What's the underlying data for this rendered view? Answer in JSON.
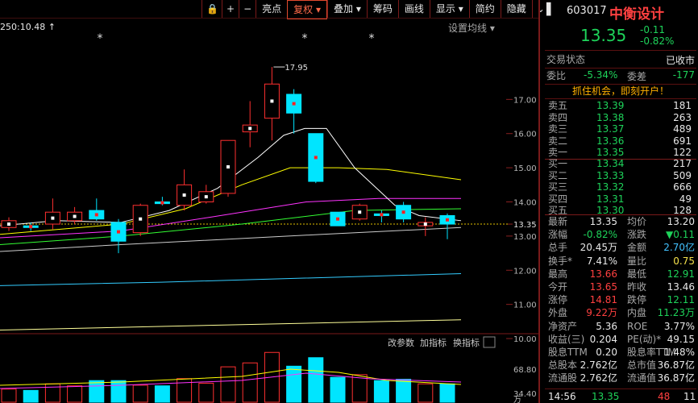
{
  "toolbar": {
    "buttons": [
      "亮点",
      "复权",
      "叠加",
      "筹码",
      "画线",
      "显示",
      "简约",
      "隐藏"
    ],
    "active": "复权"
  },
  "chart": {
    "top_left": "250:10.48",
    "ma_settings": "设置均线",
    "high_label": "17.95",
    "price_ticks": [
      "17.00",
      "16.00",
      "15.00",
      "14.00",
      "13.35",
      "13.00",
      "12.00",
      "11.00",
      "10.00"
    ],
    "vol_ticks": [
      "68.80",
      "34.40",
      "万"
    ],
    "bottom_buttons": [
      "改参数",
      "加指标",
      "换指标"
    ],
    "current_price": 13.35,
    "colors": {
      "up": "#ff3030",
      "down": "#00e5ff",
      "ma5": "#ffffff",
      "ma10": "#ffff00",
      "ma20": "#ff33ff",
      "ma30": "#33ff33",
      "ma60": "#cccccc",
      "ma120": "#33ccff",
      "ma250": "#ffff99"
    }
  },
  "chart_data": {
    "type": "candlestick",
    "ylim": [
      9.6,
      18.4
    ],
    "candles": [
      {
        "o": 13.25,
        "c": 13.45,
        "h": 13.55,
        "l": 13.15
      },
      {
        "o": 13.3,
        "c": 13.25,
        "h": 13.4,
        "l": 13.15
      },
      {
        "o": 13.35,
        "c": 13.7,
        "h": 14.1,
        "l": 13.2
      },
      {
        "o": 13.45,
        "c": 13.7,
        "h": 13.85,
        "l": 13.35
      },
      {
        "o": 13.75,
        "c": 13.5,
        "h": 14.1,
        "l": 13.45
      },
      {
        "o": 13.4,
        "c": 12.85,
        "h": 13.5,
        "l": 12.5
      },
      {
        "o": 13.1,
        "c": 13.9,
        "h": 13.95,
        "l": 13.0
      },
      {
        "o": 14.0,
        "c": 13.95,
        "h": 14.15,
        "l": 13.9
      },
      {
        "o": 13.9,
        "c": 14.5,
        "h": 14.95,
        "l": 13.75
      },
      {
        "o": 14.0,
        "c": 14.3,
        "h": 14.5,
        "l": 13.95
      },
      {
        "o": 14.25,
        "c": 15.8,
        "h": 15.8,
        "l": 14.15
      },
      {
        "o": 16.05,
        "c": 16.25,
        "h": 16.95,
        "l": 15.6
      },
      {
        "o": 16.45,
        "c": 17.45,
        "h": 17.95,
        "l": 15.8
      },
      {
        "o": 17.15,
        "c": 16.6,
        "h": 17.3,
        "l": 16.0
      },
      {
        "o": 16.0,
        "c": 14.6,
        "h": 16.0,
        "l": 14.55
      },
      {
        "o": 13.7,
        "c": 13.3,
        "h": 13.7,
        "l": 13.3
      },
      {
        "o": 13.5,
        "c": 13.9,
        "h": 13.95,
        "l": 13.45
      },
      {
        "o": 13.65,
        "c": 13.6,
        "h": 13.75,
        "l": 13.4
      },
      {
        "o": 13.9,
        "c": 13.5,
        "h": 14.0,
        "l": 13.4
      },
      {
        "o": 13.3,
        "c": 13.4,
        "h": 13.55,
        "l": 13.0
      },
      {
        "o": 13.6,
        "c": 13.35,
        "h": 13.66,
        "l": 12.91
      }
    ],
    "volumes": [
      20,
      18,
      28,
      25,
      33,
      33,
      26,
      25,
      36,
      29,
      54,
      60,
      76,
      55,
      68,
      38,
      42,
      33,
      35,
      28,
      28
    ]
  },
  "quote": {
    "code": "603017",
    "name": "中衡设计",
    "price": "13.35",
    "change": "-0.11",
    "change_pct": "-0.82%",
    "status_label": "交易状态",
    "status": "已收市",
    "ratio_label": "委比",
    "ratio": "-5.34%",
    "diff_label": "委差",
    "diff": "-177",
    "ad": "抓住机会，即刻开户！",
    "asks": [
      {
        "label": "卖五",
        "price": "13.39",
        "vol": "181"
      },
      {
        "label": "卖四",
        "price": "13.38",
        "vol": "263"
      },
      {
        "label": "卖三",
        "price": "13.37",
        "vol": "489"
      },
      {
        "label": "卖二",
        "price": "13.36",
        "vol": "691"
      },
      {
        "label": "卖一",
        "price": "13.35",
        "vol": "122"
      }
    ],
    "bids": [
      {
        "label": "买一",
        "price": "13.34",
        "vol": "217"
      },
      {
        "label": "买二",
        "price": "13.33",
        "vol": "509"
      },
      {
        "label": "买三",
        "price": "13.32",
        "vol": "666"
      },
      {
        "label": "买四",
        "price": "13.31",
        "vol": "49"
      },
      {
        "label": "买五",
        "price": "13.30",
        "vol": "128"
      }
    ],
    "stats": [
      [
        "最新",
        "13.35",
        "white",
        "均价",
        "13.20",
        "white"
      ],
      [
        "涨幅",
        "-0.82%",
        "green",
        "涨跌",
        "▼0.11",
        "green"
      ],
      [
        "总手",
        "20.45万",
        "white",
        "金额",
        "2.70亿",
        "cyan"
      ],
      [
        "换手*",
        "7.41%",
        "white",
        "量比",
        "0.75",
        "yellow"
      ],
      [
        "最高",
        "13.66",
        "red",
        "最低",
        "12.91",
        "green"
      ],
      [
        "今开",
        "13.65",
        "red",
        "昨收",
        "13.46",
        "white"
      ],
      [
        "涨停",
        "14.81",
        "red",
        "跌停",
        "12.11",
        "green"
      ],
      [
        "外盘",
        "9.22万",
        "red",
        "内盘",
        "11.23万",
        "green"
      ],
      [
        "净资产",
        "5.36",
        "white",
        "ROE",
        "3.77%",
        "white"
      ],
      [
        "收益(三)",
        "0.204",
        "white",
        "PE(动)*",
        "49.15",
        "white"
      ],
      [
        "股息TTM",
        "0.20",
        "white",
        "股息率TTM",
        "1.48%",
        "white"
      ],
      [
        "总股本",
        "2.762亿",
        "white",
        "总市值",
        "36.87亿",
        "white"
      ],
      [
        "流通股",
        "2.762亿",
        "white",
        "流通值",
        "36.87亿",
        "white"
      ]
    ],
    "footer": {
      "time": "14:56",
      "price": "13.35",
      "vol": "48",
      "count": "11"
    }
  }
}
